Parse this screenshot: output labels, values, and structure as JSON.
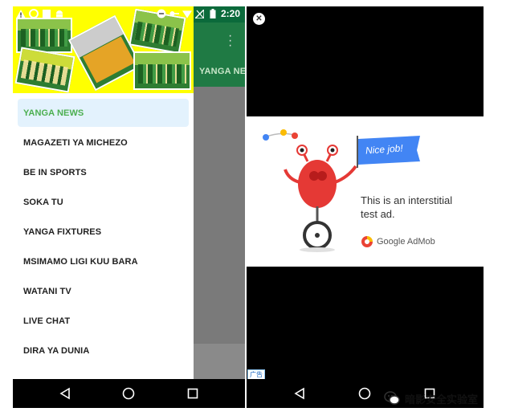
{
  "left_phone": {
    "status_bar": {
      "time": "2:20",
      "left_icons": [
        "warning-icon",
        "sync-icon",
        "square-icon",
        "android-icon"
      ],
      "right_icons": [
        "dnd-icon",
        "key-icon",
        "wifi-icon",
        "no-signal-icon",
        "battery-icon"
      ]
    },
    "app_behind": {
      "title": "YANGA NEWS"
    },
    "drawer": {
      "items": [
        {
          "label": "YANGA NEWS",
          "active": true
        },
        {
          "label": "MAGAZETI YA MICHEZO",
          "active": false
        },
        {
          "label": "BE IN SPORTS",
          "active": false
        },
        {
          "label": "SOKA TU",
          "active": false
        },
        {
          "label": "YANGA FIXTURES",
          "active": false
        },
        {
          "label": "MSIMAMO LIGI KUU BARA",
          "active": false
        },
        {
          "label": "WATANI TV",
          "active": false
        },
        {
          "label": "LIVE CHAT",
          "active": false
        },
        {
          "label": "DIRA YA DUNIA",
          "active": false
        }
      ]
    },
    "nav_bar": [
      "back-icon",
      "home-icon",
      "recents-icon"
    ]
  },
  "right_phone": {
    "close_label": "✕",
    "ad": {
      "banner": "Nice job!",
      "text_line1": "This is an interstitial",
      "text_line2": "test ad.",
      "brand": "Google AdMob"
    },
    "ad_badge": "广告",
    "nav_bar": [
      "back-icon",
      "home-icon",
      "recents-icon"
    ]
  },
  "watermark": {
    "text": "暗影安全实验室"
  },
  "colors": {
    "drawer_header": "#ffff00",
    "active_item_bg": "#e3f2fd",
    "active_item_text": "#4caf50",
    "nice_job_banner": "#4285f4"
  }
}
